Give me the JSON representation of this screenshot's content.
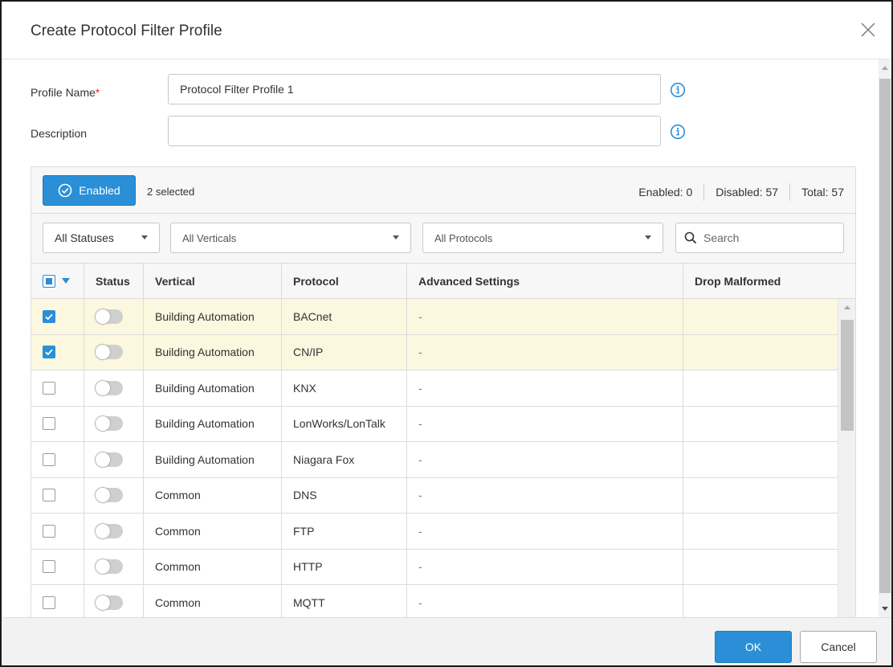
{
  "dialog": {
    "title": "Create Protocol Filter Profile",
    "close_icon": "close-icon"
  },
  "form": {
    "profile_name_label": "Profile Name",
    "profile_name_required_mark": "*",
    "profile_name_value": "Protocol Filter Profile 1",
    "description_label": "Description",
    "description_value": "",
    "info_icon": "info-circle-icon"
  },
  "toolbar": {
    "enabled_button_label": "Enabled",
    "selected_count": "2 selected",
    "enabled_count": "Enabled: 0",
    "disabled_count": "Disabled: 57",
    "total_count": "Total: 57"
  },
  "filters": {
    "status_value": "All Statuses",
    "vertical_value": "All Verticals",
    "protocol_value": "All Protocols",
    "search_placeholder": "Search"
  },
  "table": {
    "columns": [
      "Status",
      "Vertical",
      "Protocol",
      "Advanced Settings",
      "Drop Malformed"
    ],
    "rows": [
      {
        "checked": true,
        "vertical": "Building Automation",
        "protocol": "BACnet",
        "advanced": "-",
        "drop": ""
      },
      {
        "checked": true,
        "vertical": "Building Automation",
        "protocol": "CN/IP",
        "advanced": "-",
        "drop": ""
      },
      {
        "checked": false,
        "vertical": "Building Automation",
        "protocol": "KNX",
        "advanced": "-",
        "drop": ""
      },
      {
        "checked": false,
        "vertical": "Building Automation",
        "protocol": "LonWorks/LonTalk",
        "advanced": "-",
        "drop": ""
      },
      {
        "checked": false,
        "vertical": "Building Automation",
        "protocol": "Niagara Fox",
        "advanced": "-",
        "drop": ""
      },
      {
        "checked": false,
        "vertical": "Common",
        "protocol": "DNS",
        "advanced": "-",
        "drop": ""
      },
      {
        "checked": false,
        "vertical": "Common",
        "protocol": "FTP",
        "advanced": "-",
        "drop": ""
      },
      {
        "checked": false,
        "vertical": "Common",
        "protocol": "HTTP",
        "advanced": "-",
        "drop": ""
      },
      {
        "checked": false,
        "vertical": "Common",
        "protocol": "MQTT",
        "advanced": "-",
        "drop": ""
      }
    ]
  },
  "footer": {
    "ok_label": "OK",
    "cancel_label": "Cancel"
  },
  "colors": {
    "accent": "#2a8fd6",
    "selected_row": "#fbf8df",
    "required": "#d32f2f"
  }
}
